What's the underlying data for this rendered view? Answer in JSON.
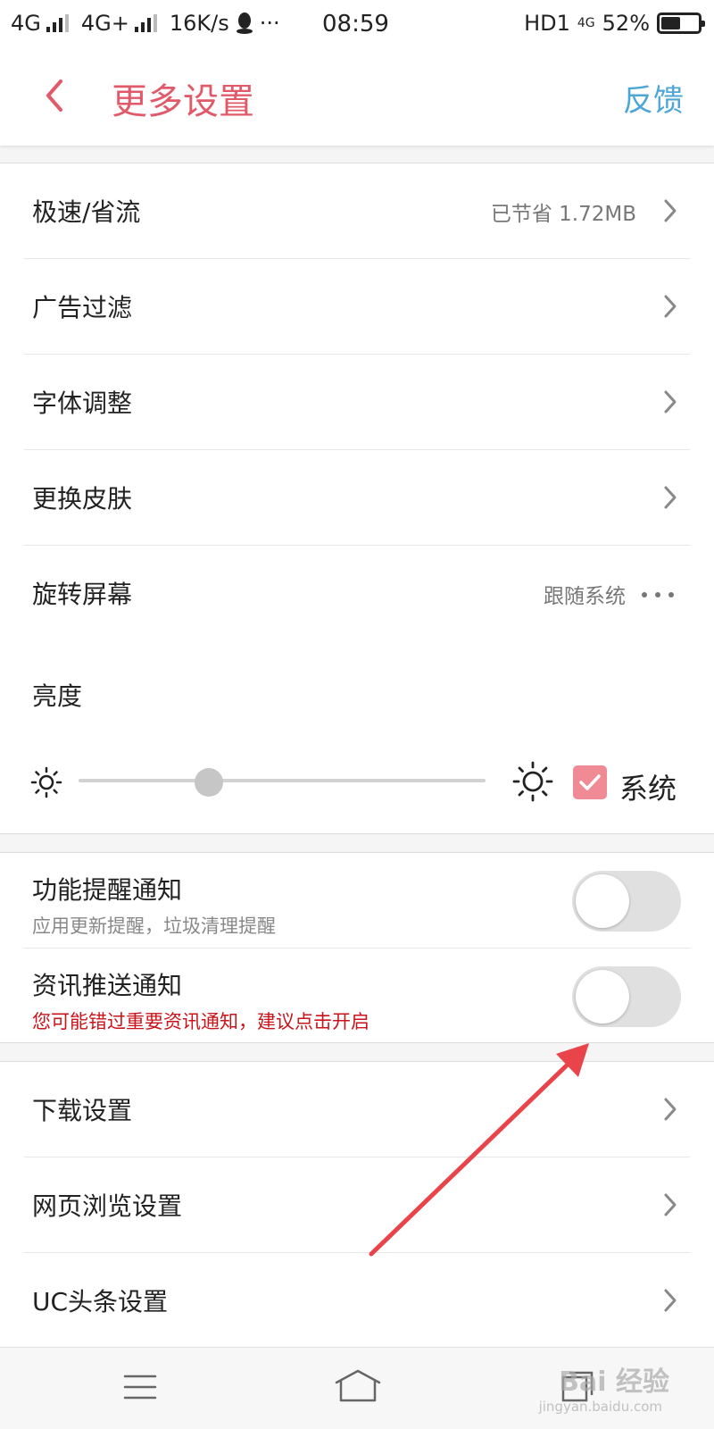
{
  "status_bar": {
    "network1": "4G",
    "network2": "4G+",
    "speed": "16K/s",
    "more": "···",
    "time": "08:59",
    "hd": "HD1",
    "net_small": "4G",
    "battery": "52%",
    "battery_level": 0.52
  },
  "header": {
    "title": "更多设置",
    "feedback": "反馈",
    "accent_color": "#e05a6a",
    "link_color": "#4da7d6"
  },
  "settings1": [
    {
      "label": "极速/省流",
      "value": "已节省 1.72MB",
      "trailing": "chevron-right-icon"
    },
    {
      "label": "广告过滤",
      "value": "",
      "trailing": "chevron-right-icon"
    },
    {
      "label": "字体调整",
      "value": "",
      "trailing": "chevron-right-icon"
    },
    {
      "label": "更换皮肤",
      "value": "",
      "trailing": "chevron-right-icon"
    },
    {
      "label": "旋转屏幕",
      "value": "跟随系统",
      "trailing": "more-dots-icon"
    }
  ],
  "brightness": {
    "label": "亮度",
    "level": 0.32,
    "system_label": "系统",
    "system_checked": true,
    "check_color": "#f08a95"
  },
  "notifications": [
    {
      "title": "功能提醒通知",
      "subtitle": "应用更新提醒，垃圾清理提醒",
      "warning": false,
      "on": false
    },
    {
      "title": "资讯推送通知",
      "subtitle": "您可能错过重要资讯通知，建议点击开启",
      "warning": true,
      "on": false
    }
  ],
  "settings2": [
    {
      "label": "下载设置",
      "trailing": "chevron-right-icon"
    },
    {
      "label": "网页浏览设置",
      "trailing": "chevron-right-icon"
    },
    {
      "label": "UC头条设置",
      "trailing": "chevron-right-icon"
    }
  ],
  "bottom_nav": {
    "menu": "menu-icon",
    "home": "home-icon",
    "tabs": "tabs-icon"
  },
  "watermark": {
    "text": "Bai 经验",
    "url": "jingyan.baidu.com"
  },
  "annotation": {
    "arrow_color": "#e8444a"
  }
}
